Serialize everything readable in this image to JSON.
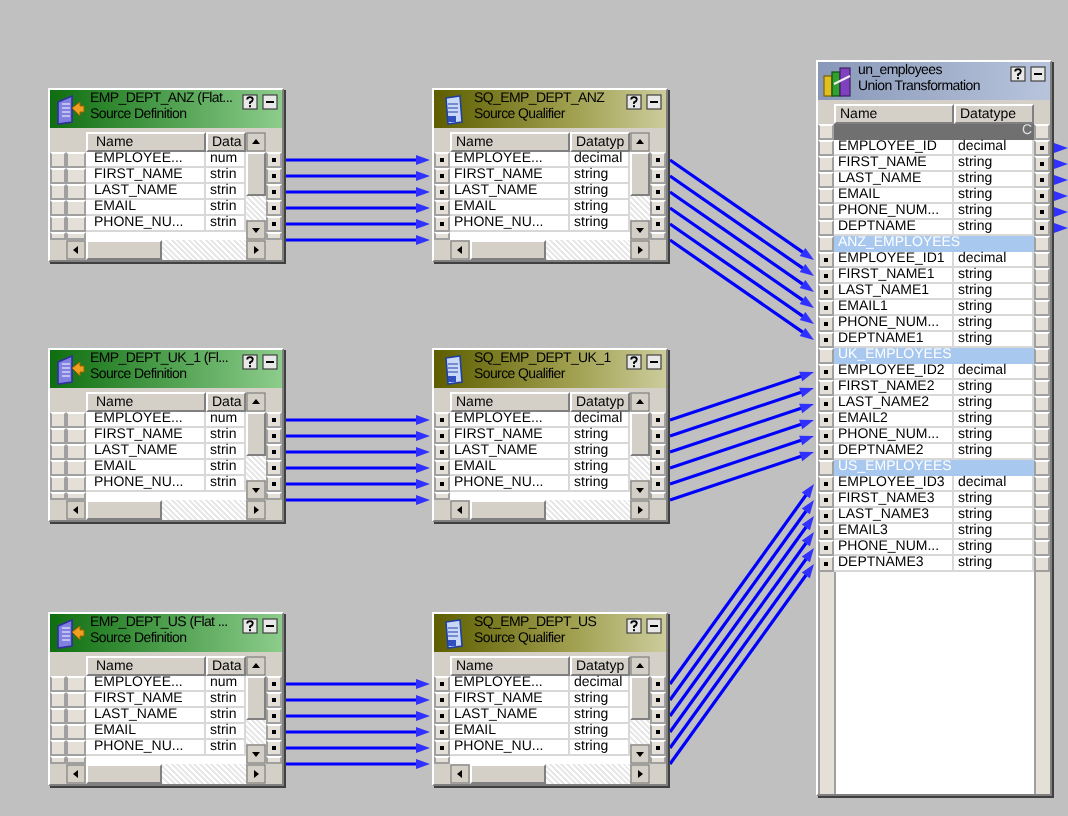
{
  "pipelines": [
    {
      "source": {
        "title": "EMP_DEPT_ANZ (Flat...",
        "subtitle": "Source Definition",
        "columns": [
          "Name",
          "Data"
        ],
        "rows": [
          {
            "name": "EMPLOYEE...",
            "type": "num"
          },
          {
            "name": "FIRST_NAME",
            "type": "strin"
          },
          {
            "name": "LAST_NAME",
            "type": "strin"
          },
          {
            "name": "EMAIL",
            "type": "strin"
          },
          {
            "name": "PHONE_NU...",
            "type": "strin"
          }
        ]
      },
      "qualifier": {
        "title": "SQ_EMP_DEPT_ANZ",
        "subtitle": "Source Qualifier",
        "columns": [
          "Name",
          "Datatyp"
        ],
        "rows": [
          {
            "name": "EMPLOYEE...",
            "type": "decimal"
          },
          {
            "name": "FIRST_NAME",
            "type": "string"
          },
          {
            "name": "LAST_NAME",
            "type": "string"
          },
          {
            "name": "EMAIL",
            "type": "string"
          },
          {
            "name": "PHONE_NU...",
            "type": "string"
          }
        ]
      }
    },
    {
      "source": {
        "title": "EMP_DEPT_UK_1 (Fl...",
        "subtitle": "Source Definition",
        "columns": [
          "Name",
          "Data"
        ],
        "rows": [
          {
            "name": "EMPLOYEE...",
            "type": "num"
          },
          {
            "name": "FIRST_NAME",
            "type": "strin"
          },
          {
            "name": "LAST_NAME",
            "type": "strin"
          },
          {
            "name": "EMAIL",
            "type": "strin"
          },
          {
            "name": "PHONE_NU...",
            "type": "strin"
          }
        ]
      },
      "qualifier": {
        "title": "SQ_EMP_DEPT_UK_1",
        "subtitle": "Source Qualifier",
        "columns": [
          "Name",
          "Datatyp"
        ],
        "rows": [
          {
            "name": "EMPLOYEE...",
            "type": "decimal"
          },
          {
            "name": "FIRST_NAME",
            "type": "string"
          },
          {
            "name": "LAST_NAME",
            "type": "string"
          },
          {
            "name": "EMAIL",
            "type": "string"
          },
          {
            "name": "PHONE_NU...",
            "type": "string"
          }
        ]
      }
    },
    {
      "source": {
        "title": "EMP_DEPT_US (Flat ...",
        "subtitle": "Source Definition",
        "columns": [
          "Name",
          "Data"
        ],
        "rows": [
          {
            "name": "EMPLOYEE...",
            "type": "num"
          },
          {
            "name": "FIRST_NAME",
            "type": "strin"
          },
          {
            "name": "LAST_NAME",
            "type": "strin"
          },
          {
            "name": "EMAIL",
            "type": "strin"
          },
          {
            "name": "PHONE_NU...",
            "type": "strin"
          }
        ]
      },
      "qualifier": {
        "title": "SQ_EMP_DEPT_US",
        "subtitle": "Source Qualifier",
        "columns": [
          "Name",
          "Datatyp"
        ],
        "rows": [
          {
            "name": "EMPLOYEE...",
            "type": "decimal"
          },
          {
            "name": "FIRST_NAME",
            "type": "string"
          },
          {
            "name": "LAST_NAME",
            "type": "string"
          },
          {
            "name": "EMAIL",
            "type": "string"
          },
          {
            "name": "PHONE_NU...",
            "type": "string"
          }
        ]
      }
    }
  ],
  "union": {
    "title": "un_employees",
    "subtitle": "Union Transformation",
    "columns": [
      "Name",
      "Datatype"
    ],
    "output_group": {
      "label": "C",
      "rows": [
        {
          "name": "EMPLOYEE_ID",
          "type": "decimal"
        },
        {
          "name": "FIRST_NAME",
          "type": "string"
        },
        {
          "name": "LAST_NAME",
          "type": "string"
        },
        {
          "name": "EMAIL",
          "type": "string"
        },
        {
          "name": "PHONE_NUM...",
          "type": "string"
        },
        {
          "name": "DEPTNAME",
          "type": "string"
        }
      ]
    },
    "input_groups": [
      {
        "label": "ANZ_EMPLOYEES",
        "rows": [
          {
            "name": "EMPLOYEE_ID1",
            "type": "decimal"
          },
          {
            "name": "FIRST_NAME1",
            "type": "string"
          },
          {
            "name": "LAST_NAME1",
            "type": "string"
          },
          {
            "name": "EMAIL1",
            "type": "string"
          },
          {
            "name": "PHONE_NUM...",
            "type": "string"
          },
          {
            "name": "DEPTNAME1",
            "type": "string"
          }
        ]
      },
      {
        "label": "UK_EMPLOYEES",
        "rows": [
          {
            "name": "EMPLOYEE_ID2",
            "type": "decimal"
          },
          {
            "name": "FIRST_NAME2",
            "type": "string"
          },
          {
            "name": "LAST_NAME2",
            "type": "string"
          },
          {
            "name": "EMAIL2",
            "type": "string"
          },
          {
            "name": "PHONE_NUM...",
            "type": "string"
          },
          {
            "name": "DEPTNAME2",
            "type": "string"
          }
        ]
      },
      {
        "label": "US_EMPLOYEES",
        "rows": [
          {
            "name": "EMPLOYEE_ID3",
            "type": "decimal"
          },
          {
            "name": "FIRST_NAME3",
            "type": "string"
          },
          {
            "name": "LAST_NAME3",
            "type": "string"
          },
          {
            "name": "EMAIL3",
            "type": "string"
          },
          {
            "name": "PHONE_NUM...",
            "type": "string"
          },
          {
            "name": "DEPTNAME3",
            "type": "string"
          }
        ]
      }
    ]
  }
}
